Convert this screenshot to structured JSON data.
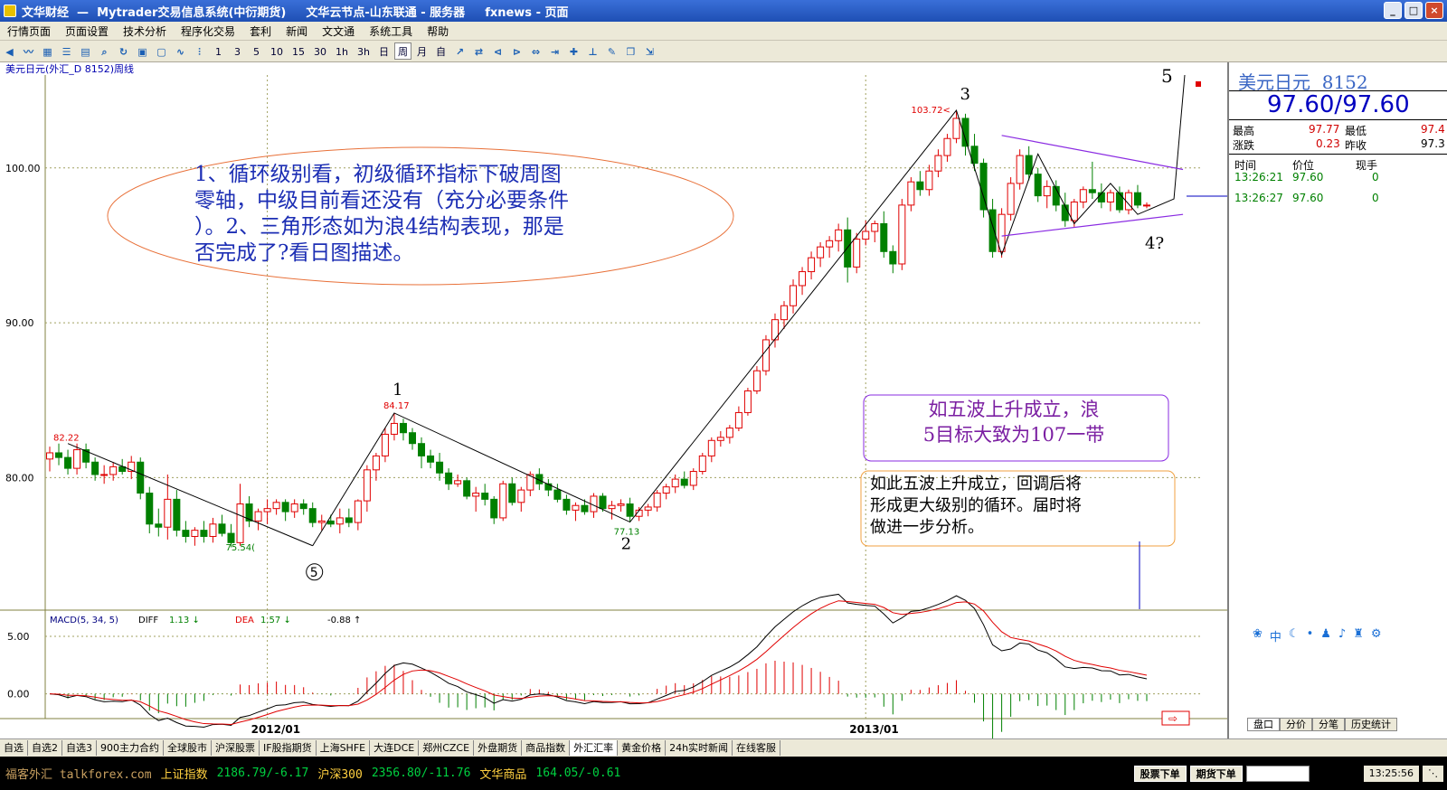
{
  "window": {
    "title_segments": [
      "文华财经  —  Mytrader交易信息系统(中衍期货)",
      "文华云节点-山东联通 - 服务器",
      "fxnews - 页面"
    ],
    "buttons": [
      "_",
      "□",
      "×"
    ]
  },
  "menu": [
    "行情页面",
    "页面设置",
    "技术分析",
    "程序化交易",
    "套利",
    "新闻",
    "文文通",
    "系统工具",
    "帮助"
  ],
  "toolbar": {
    "periods": [
      "1",
      "3",
      "5",
      "10",
      "15",
      "30",
      "1h",
      "3h",
      "日",
      "周",
      "月",
      "自"
    ],
    "active_period": "周"
  },
  "chart": {
    "header": "美元日元(外汇_D 8152)周线",
    "price_ticks": [
      "100.00",
      "90.00",
      "80.00"
    ],
    "date_ticks": [
      "2012/01",
      "2013/01"
    ],
    "wave_labels": [
      "3",
      "1",
      "2",
      "5",
      "4?"
    ],
    "price_annotations": [
      "103.72",
      "84.17",
      "82.22",
      "77.13",
      "75.54"
    ],
    "wave_circle": "5",
    "annotation_main": [
      "1、循环级别看，初级循环指标下破周图",
      "零轴，中级目前看还没有（充分必要条件",
      "）。2、三角形态如为浪4结构表现，那是",
      "否完成了?看日图描述。"
    ],
    "annotation_target": [
      "如五波上升成立，浪",
      "5目标大致为107一带"
    ],
    "annotation_next": [
      "如此五波上升成立，回调后将",
      "形成更大级别的循环。届时将",
      "做进一步分析。"
    ],
    "macd": {
      "title": "MACD(5, 34, 5)",
      "diff_label": "DIFF",
      "diff_value": "1.13 ↓",
      "dea_label": "DEA",
      "dea_value": "1.57 ↓",
      "macd_value": "-0.88 ↑",
      "ticks": [
        "5.00",
        "0.00"
      ]
    }
  },
  "sidebar": {
    "title": "美元日元  8152",
    "bid_ask": "97.60/97.60",
    "high_label": "最高",
    "high_value": "97.77",
    "low_label": "最低",
    "low_value": "97.4",
    "change_label": "涨跌",
    "change_value": "0.23",
    "prev_label": "昨收",
    "prev_value": "97.3",
    "ticks_header": [
      "时间",
      "价位",
      "现手"
    ],
    "ticks": [
      [
        "13:26:21",
        "97.60",
        "0"
      ],
      [
        "13:26:27",
        "97.60",
        "0"
      ]
    ],
    "icons": [
      "paw-icon",
      "中",
      "moon-icon",
      "dot-icon",
      "person-icon",
      "mic-icon",
      "shirt-icon",
      "gear-icon"
    ],
    "tabs": [
      "盘口",
      "分价",
      "分笔",
      "历史统计"
    ]
  },
  "bottom_tabs": [
    "自选",
    "自选2",
    "自选3",
    "900主力合约",
    "全球股市",
    "沪深股票",
    "IF股指期货",
    "上海SHFE",
    "大连DCE",
    "郑州CZCE",
    "外盘期货",
    "商品指数",
    "外汇汇率",
    "黄金价格",
    "24h实时新闻",
    "在线客服"
  ],
  "active_bottom_tab": "外汇汇率",
  "status": {
    "index_label": "上证指数",
    "index_value": "2186.79/-6.17",
    "hs_label": "沪深300",
    "hs_value": "2356.80/-11.76",
    "wh_label": "文华商品",
    "wh_value": "164.05/-0.61",
    "stock_btn": "股票下单",
    "futures_btn": "期货下单",
    "clock": "13:25:56",
    "watermark": "福客外汇 talkforex.com"
  },
  "chart_data": {
    "type": "candlestick",
    "title": "美元日元(外汇_D 8152)周线",
    "ylim": [
      71.5,
      106
    ],
    "y_ticks": [
      100,
      90,
      80
    ],
    "points": [
      [
        81.2,
        82.0,
        80.4,
        81.6
      ],
      [
        81.6,
        82.2,
        80.8,
        81.3
      ],
      [
        81.3,
        81.8,
        80.2,
        80.6
      ],
      [
        80.6,
        82.2,
        80.2,
        81.8
      ],
      [
        81.8,
        82.2,
        80.6,
        81.0
      ],
      [
        81.0,
        81.3,
        79.8,
        80.2
      ],
      [
        80.2,
        80.8,
        79.6,
        80.2
      ],
      [
        80.2,
        81.0,
        79.8,
        80.7
      ],
      [
        80.7,
        81.2,
        80.2,
        80.4
      ],
      [
        80.4,
        81.4,
        79.9,
        81.0
      ],
      [
        81.0,
        81.3,
        78.6,
        79.0
      ],
      [
        79.0,
        79.4,
        76.4,
        77.0
      ],
      [
        77.0,
        78.0,
        76.2,
        76.8
      ],
      [
        76.8,
        80.2,
        76.0,
        78.6
      ],
      [
        78.6,
        79.2,
        76.2,
        76.6
      ],
      [
        76.6,
        77.2,
        75.8,
        76.2
      ],
      [
        76.2,
        76.8,
        75.6,
        76.6
      ],
      [
        76.6,
        77.2,
        75.8,
        76.2
      ],
      [
        76.2,
        77.4,
        75.8,
        77.0
      ],
      [
        77.0,
        77.6,
        76.2,
        76.4
      ],
      [
        76.4,
        77.0,
        75.5,
        75.8
      ],
      [
        75.8,
        79.6,
        75.6,
        78.3
      ],
      [
        78.3,
        78.8,
        76.8,
        77.2
      ],
      [
        77.2,
        78.0,
        76.6,
        77.8
      ],
      [
        77.8,
        78.6,
        77.0,
        78.0
      ],
      [
        78.0,
        78.6,
        77.6,
        78.4
      ],
      [
        78.4,
        78.6,
        77.2,
        77.8
      ],
      [
        77.8,
        78.6,
        77.4,
        78.3
      ],
      [
        78.3,
        78.6,
        77.6,
        78.0
      ],
      [
        78.0,
        78.4,
        76.8,
        77.1
      ],
      [
        77.1,
        77.6,
        76.6,
        77.2
      ],
      [
        77.2,
        77.6,
        76.8,
        77.0
      ],
      [
        77.0,
        78.0,
        76.4,
        77.4
      ],
      [
        77.4,
        78.0,
        76.8,
        77.1
      ],
      [
        77.1,
        78.6,
        76.6,
        78.5
      ],
      [
        78.5,
        80.8,
        77.8,
        80.5
      ],
      [
        80.5,
        81.6,
        79.8,
        81.4
      ],
      [
        81.4,
        83.2,
        81.0,
        82.8
      ],
      [
        82.8,
        84.17,
        82.4,
        83.5
      ],
      [
        83.5,
        83.8,
        82.4,
        82.9
      ],
      [
        82.9,
        83.2,
        81.8,
        82.2
      ],
      [
        82.2,
        82.6,
        80.6,
        81.4
      ],
      [
        81.4,
        81.8,
        80.6,
        81.0
      ],
      [
        81.0,
        81.6,
        79.8,
        80.3
      ],
      [
        80.3,
        80.6,
        79.2,
        79.6
      ],
      [
        79.6,
        80.2,
        79.4,
        79.8
      ],
      [
        79.8,
        80.0,
        78.6,
        78.8
      ],
      [
        78.8,
        79.4,
        77.8,
        79.0
      ],
      [
        79.0,
        79.6,
        78.2,
        78.6
      ],
      [
        78.6,
        78.8,
        77.0,
        77.4
      ],
      [
        77.4,
        79.8,
        77.2,
        79.6
      ],
      [
        79.6,
        80.0,
        78.2,
        78.4
      ],
      [
        78.4,
        79.4,
        77.8,
        79.2
      ],
      [
        79.2,
        80.4,
        78.8,
        80.2
      ],
      [
        80.2,
        80.6,
        79.2,
        79.6
      ],
      [
        79.6,
        79.9,
        78.8,
        79.2
      ],
      [
        79.2,
        79.6,
        78.4,
        78.6
      ],
      [
        78.6,
        78.9,
        77.6,
        77.9
      ],
      [
        77.9,
        78.4,
        77.2,
        78.2
      ],
      [
        78.2,
        78.6,
        77.6,
        77.8
      ],
      [
        77.8,
        79.0,
        77.4,
        78.8
      ],
      [
        78.8,
        79.0,
        77.8,
        78.0
      ],
      [
        78.0,
        78.5,
        77.3,
        78.2
      ],
      [
        78.2,
        78.6,
        77.8,
        78.3
      ],
      [
        78.3,
        78.7,
        77.13,
        77.5
      ],
      [
        77.5,
        78.1,
        77.2,
        77.9
      ],
      [
        77.9,
        78.3,
        77.5,
        78.1
      ],
      [
        78.1,
        79.2,
        77.8,
        79.0
      ],
      [
        79.0,
        79.6,
        78.6,
        79.4
      ],
      [
        79.4,
        80.2,
        79.0,
        79.9
      ],
      [
        79.9,
        80.4,
        79.3,
        79.5
      ],
      [
        79.5,
        80.6,
        79.2,
        80.4
      ],
      [
        80.4,
        81.6,
        80.2,
        81.4
      ],
      [
        81.4,
        82.6,
        81.0,
        82.4
      ],
      [
        82.4,
        83.0,
        82.0,
        82.6
      ],
      [
        82.6,
        83.4,
        82.2,
        83.2
      ],
      [
        83.2,
        84.6,
        83.0,
        84.2
      ],
      [
        84.2,
        85.8,
        84.0,
        85.6
      ],
      [
        85.6,
        87.2,
        85.4,
        86.9
      ],
      [
        86.9,
        89.2,
        86.6,
        88.9
      ],
      [
        88.9,
        90.6,
        88.4,
        90.2
      ],
      [
        90.2,
        91.4,
        89.6,
        91.1
      ],
      [
        91.1,
        92.8,
        90.6,
        92.4
      ],
      [
        92.4,
        93.6,
        91.8,
        93.3
      ],
      [
        93.3,
        94.6,
        92.8,
        94.2
      ],
      [
        94.2,
        95.2,
        93.6,
        94.9
      ],
      [
        94.9,
        95.6,
        94.2,
        95.3
      ],
      [
        95.3,
        96.4,
        94.6,
        96.0
      ],
      [
        96.0,
        96.8,
        92.6,
        93.6
      ],
      [
        93.6,
        95.8,
        93.2,
        95.4
      ],
      [
        95.4,
        96.6,
        95.0,
        95.9
      ],
      [
        95.9,
        96.6,
        95.2,
        96.4
      ],
      [
        96.4,
        97.2,
        94.2,
        94.6
      ],
      [
        94.6,
        95.0,
        93.2,
        93.8
      ],
      [
        93.8,
        98.0,
        93.4,
        97.6
      ],
      [
        97.6,
        99.4,
        97.2,
        99.1
      ],
      [
        99.1,
        99.8,
        98.2,
        98.6
      ],
      [
        98.6,
        100.2,
        98.2,
        99.8
      ],
      [
        99.8,
        101.2,
        99.4,
        100.8
      ],
      [
        100.8,
        102.2,
        100.4,
        101.9
      ],
      [
        101.9,
        103.72,
        101.6,
        103.2
      ],
      [
        103.2,
        103.5,
        100.8,
        101.4
      ],
      [
        101.4,
        102.2,
        99.8,
        100.3
      ],
      [
        100.3,
        100.6,
        96.8,
        97.3
      ],
      [
        97.3,
        98.0,
        94.2,
        94.6
      ],
      [
        94.6,
        97.4,
        94.2,
        97.0
      ],
      [
        97.0,
        99.4,
        96.6,
        99.0
      ],
      [
        99.0,
        101.2,
        98.6,
        100.8
      ],
      [
        100.8,
        101.4,
        99.2,
        99.6
      ],
      [
        99.6,
        100.0,
        97.8,
        98.2
      ],
      [
        98.2,
        99.2,
        97.4,
        98.8
      ],
      [
        98.8,
        99.2,
        97.2,
        97.6
      ],
      [
        97.6,
        98.4,
        96.2,
        96.6
      ],
      [
        96.6,
        98.0,
        96.2,
        97.8
      ],
      [
        97.8,
        98.8,
        97.4,
        98.6
      ],
      [
        98.6,
        100.4,
        98.0,
        98.4
      ],
      [
        98.4,
        99.0,
        97.4,
        97.8
      ],
      [
        97.8,
        98.6,
        97.2,
        98.4
      ],
      [
        98.4,
        98.8,
        97.1,
        97.3
      ],
      [
        97.3,
        98.6,
        97.0,
        98.4
      ],
      [
        98.4,
        98.9,
        97.4,
        97.6
      ],
      [
        97.6,
        97.77,
        97.4,
        97.6
      ]
    ],
    "annotations": {
      "103.72": "3",
      "84.17": "1",
      "77.13": "2",
      "75.54": "5"
    },
    "macd_panel": {
      "diff": 1.13,
      "dea": 1.57,
      "macd": -0.88,
      "ylim": [
        -2,
        6.5
      ]
    }
  }
}
